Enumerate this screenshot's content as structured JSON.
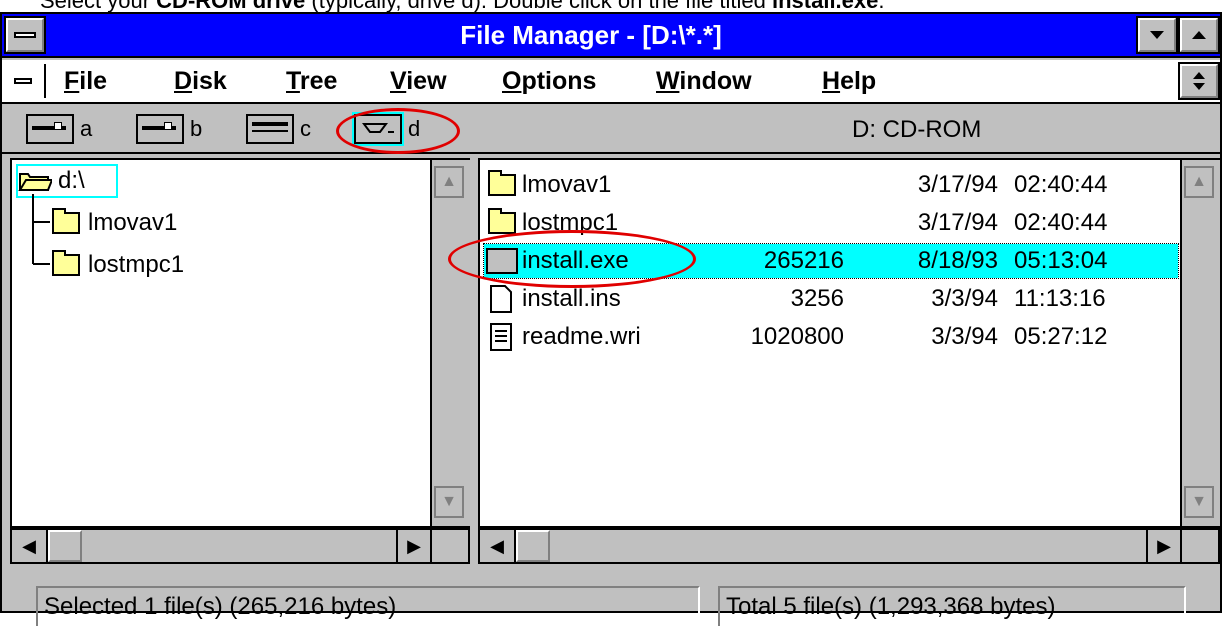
{
  "instruction": {
    "prefix": "Select your ",
    "bold1": "CD-ROM drive",
    "middle": " (typically, drive d). Double click on the file titled ",
    "bold2": "install.exe",
    "suffix": "."
  },
  "window": {
    "title": "File Manager - [D:\\*.*]"
  },
  "menu": [
    "File",
    "Disk",
    "Tree",
    "View",
    "Options",
    "Window",
    "Help"
  ],
  "menu_mnemonics": [
    "F",
    "D",
    "T",
    "V",
    "O",
    "W",
    "H"
  ],
  "drives": [
    {
      "letter": "a",
      "type": "floppy"
    },
    {
      "letter": "b",
      "type": "floppy"
    },
    {
      "letter": "c",
      "type": "hard-disk"
    },
    {
      "letter": "d",
      "type": "cd-rom",
      "selected": true
    }
  ],
  "drive_label": "D: CD-ROM",
  "tree": {
    "root": "d:\\",
    "children": [
      "lmovav1",
      "lostmpc1"
    ]
  },
  "files": [
    {
      "name": "lmovav1",
      "size": "",
      "date": "3/17/94",
      "time": "02:40:44",
      "icon": "folder-icon"
    },
    {
      "name": "lostmpc1",
      "size": "",
      "date": "3/17/94",
      "time": "02:40:44",
      "icon": "folder-icon"
    },
    {
      "name": "install.exe",
      "size": "265216",
      "date": "8/18/93",
      "time": "05:13:04",
      "icon": "program-icon",
      "selected": true
    },
    {
      "name": "install.ins",
      "size": "3256",
      "date": "3/3/94",
      "time": "11:13:16",
      "icon": "file-icon"
    },
    {
      "name": "readme.wri",
      "size": "1020800",
      "date": "3/3/94",
      "time": "05:27:12",
      "icon": "document-icon"
    }
  ],
  "status": {
    "left": "Selected 1 file(s) (265,216 bytes)",
    "right": "Total 5 file(s) (1,293,368 bytes)"
  },
  "colors": {
    "title_bar": "#0000ff",
    "selection": "#00ffff",
    "highlight_circle": "#e00000",
    "chrome": "#c0c0c0"
  }
}
